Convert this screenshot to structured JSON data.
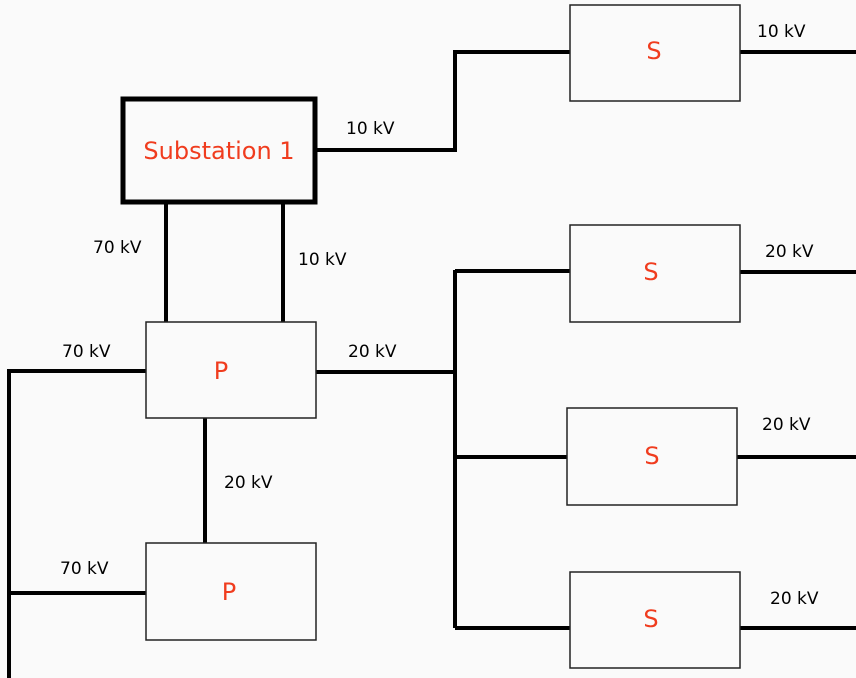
{
  "colors": {
    "node_text": "#f03c1e",
    "wire": "#000000",
    "background": "#fafafa"
  },
  "nodes": {
    "substation": "Substation 1",
    "p1": "P",
    "p2": "P",
    "s1": "S",
    "s2": "S",
    "s3": "S",
    "s4": "S"
  },
  "labels": {
    "s1_out": "10 kV",
    "sub_to_s1": "10 kV",
    "sub_p1_left": "70 kV",
    "sub_p1_right": "10 kV",
    "p1_left": "70 kV",
    "p1_right": "20 kV",
    "s2_out": "20 kV",
    "s3_out": "20 kV",
    "p1_p2": "20 kV",
    "p2_left": "70 kV",
    "s4_out": "20 kV"
  }
}
